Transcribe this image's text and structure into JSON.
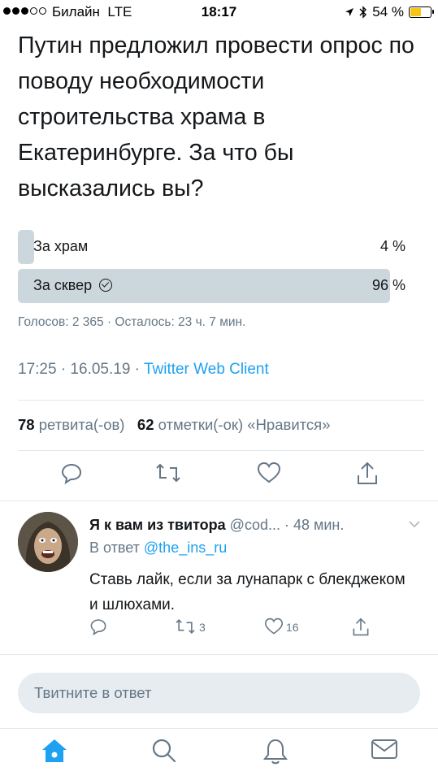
{
  "status_bar": {
    "carrier": "Билайн",
    "network": "LTE",
    "time": "18:17",
    "battery": "54 %",
    "battery_level": 0.54
  },
  "tweet": {
    "text": "Путин предложил провести опрос по поводу необходимости строительства храма в Екатеринбурге. За что бы высказались вы?",
    "poll": {
      "options": [
        {
          "label": "За храм",
          "percent": "4 %",
          "value": 4,
          "selected": false
        },
        {
          "label": "За сквер",
          "percent": "96 %",
          "value": 96,
          "selected": true
        }
      ],
      "meta": "Голосов: 2 365 · Осталось: 23 ч. 7 мин."
    },
    "timestamp": "17:25 · 16.05.19 · ",
    "client": "Twitter Web Client",
    "retweets_count": "78",
    "retweets_label": "ретвита(-ов)",
    "likes_count": "62",
    "likes_label": "отметки(-ок) «Нравится»",
    "actions": [
      "reply-icon",
      "retweet-icon",
      "like-icon",
      "share-icon"
    ]
  },
  "reply": {
    "name": "Я к вам из твитора",
    "handle": "@cod...",
    "time": "· 48 мин.",
    "in_reply_prefix": "В ответ",
    "in_reply_user": "@the_ins_ru",
    "text": "Ставь лайк, если за лунапарк с блекджеком и шлюхами.",
    "retweets": "3",
    "likes": "16"
  },
  "compose": {
    "placeholder": "Твитните в ответ"
  },
  "tabbar": {
    "items": [
      "home-icon",
      "search-icon",
      "notifications-icon",
      "messages-icon"
    ],
    "accent": "#1da1f2"
  }
}
